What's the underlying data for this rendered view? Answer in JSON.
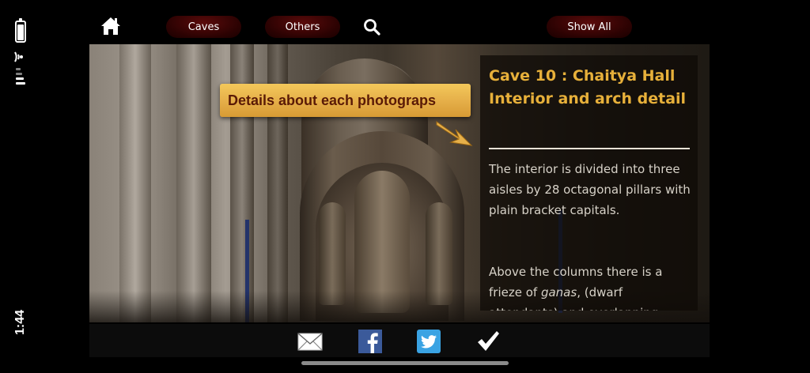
{
  "status_bar": {
    "time": "1:44"
  },
  "nav": {
    "home_icon": "home-icon",
    "caves_label": "Caves",
    "others_label": "Others",
    "search_icon": "search-icon",
    "show_all_label": "Show All"
  },
  "callout": {
    "text": "Details about each photograps"
  },
  "info": {
    "title": "Cave 10 : Chaitya Hall Interior and arch detail",
    "paragraph_1": "The interior is divided into three aisles by 28 octagonal pillars with plain bracket capitals.",
    "paragraph_2_prefix": "Above the columns there is a frieze of ",
    "paragraph_2_italic": "ganas",
    "paragraph_2_suffix": ", (dwarf attendants) and overlapping"
  },
  "share": {
    "mail_icon": "mail-icon",
    "facebook_icon": "facebook-icon",
    "twitter_icon": "twitter-icon",
    "check_icon": "check-icon"
  },
  "colors": {
    "accent_gold": "#e7b03a",
    "pill_dark_red": "#2a0202",
    "callout_text": "#5a1a06"
  }
}
